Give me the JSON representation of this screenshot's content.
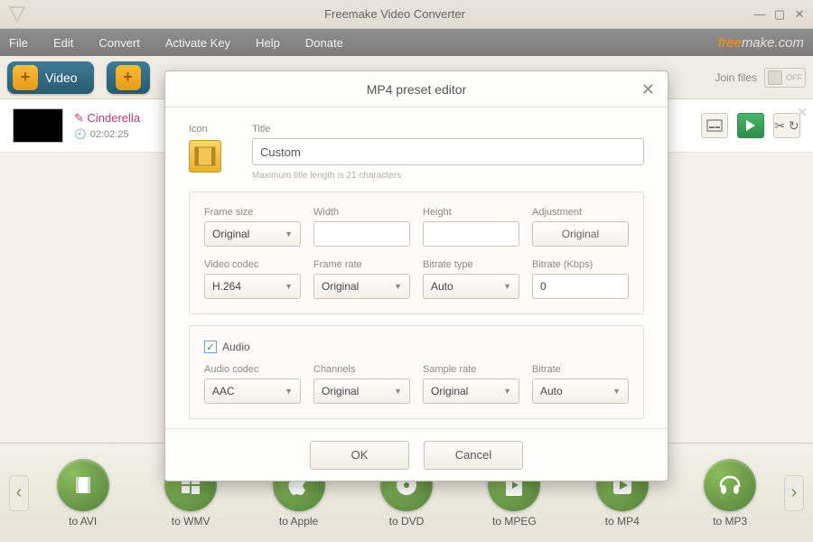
{
  "window": {
    "title": "Freemake Video Converter",
    "brand_free": "free",
    "brand_make": "make.com"
  },
  "menu": {
    "items": [
      "File",
      "Edit",
      "Convert",
      "Activate Key",
      "Help",
      "Donate"
    ]
  },
  "toolbar": {
    "video_label": "Video"
  },
  "join": {
    "label": "Join files",
    "state": "OFF"
  },
  "file": {
    "title": "Cinderella",
    "duration": "02:02:25"
  },
  "modal": {
    "title": "MP4 preset editor",
    "icon_label": "Icon",
    "title_label": "Title",
    "title_value": "Custom",
    "title_hint": "Maximum title length is 21 characters",
    "video": {
      "frame_size_label": "Frame size",
      "frame_size_value": "Original",
      "width_label": "Width",
      "width_value": "",
      "height_label": "Height",
      "height_value": "",
      "adjustment_label": "Adjustment",
      "adjustment_value": "Original",
      "codec_label": "Video codec",
      "codec_value": "H.264",
      "framerate_label": "Frame rate",
      "framerate_value": "Original",
      "bitrate_type_label": "Bitrate type",
      "bitrate_type_value": "Auto",
      "bitrate_label": "Bitrate (Kbps)",
      "bitrate_value": "0"
    },
    "audio": {
      "checkbox_label": "Audio",
      "codec_label": "Audio codec",
      "codec_value": "AAC",
      "channels_label": "Channels",
      "channels_value": "Original",
      "sample_label": "Sample rate",
      "sample_value": "Original",
      "bitrate_label": "Bitrate",
      "bitrate_value": "Auto"
    },
    "ok": "OK",
    "cancel": "Cancel"
  },
  "outputs": {
    "items": [
      "to AVI",
      "to WMV",
      "to Apple",
      "to DVD",
      "to MPEG",
      "to MP4",
      "to MP3"
    ]
  }
}
